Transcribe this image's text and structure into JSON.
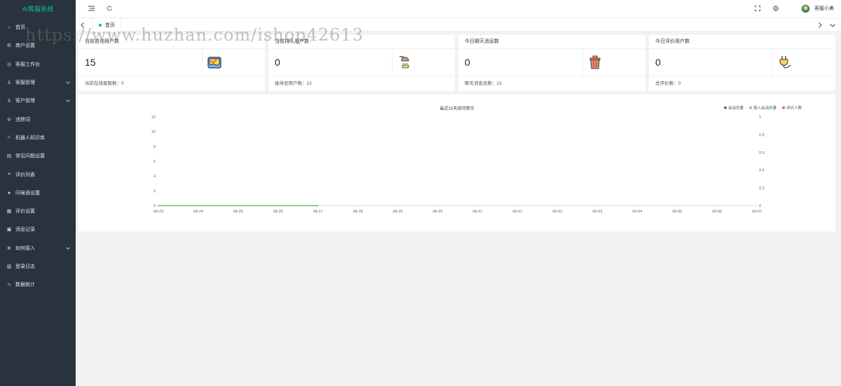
{
  "app": {
    "title": "AI客服系统",
    "brand_color": "#16baaa"
  },
  "sidebar": {
    "items": [
      {
        "label": "首页",
        "icon": "home-icon",
        "has_children": false
      },
      {
        "label": "商户设置",
        "icon": "settings-icon",
        "has_children": false
      },
      {
        "label": "客服工作台",
        "icon": "workbench-icon",
        "has_children": false
      },
      {
        "label": "客服管理",
        "icon": "user-icon",
        "has_children": true
      },
      {
        "label": "客户管理",
        "icon": "users-icon",
        "has_children": true
      },
      {
        "label": "违禁词",
        "icon": "ban-icon",
        "has_children": false
      },
      {
        "label": "机器人知识库",
        "icon": "robot-icon",
        "has_children": false
      },
      {
        "label": "常见问题设置",
        "icon": "faq-icon",
        "has_children": false
      },
      {
        "label": "评价列表",
        "icon": "list-icon",
        "has_children": false
      },
      {
        "label": "问候语设置",
        "icon": "send-icon",
        "has_children": false
      },
      {
        "label": "评价设置",
        "icon": "calendar-icon",
        "has_children": false
      },
      {
        "label": "消息记录",
        "icon": "message-icon",
        "has_children": false
      },
      {
        "label": "如何接入",
        "icon": "link-icon",
        "has_children": true
      },
      {
        "label": "登录日志",
        "icon": "log-icon",
        "has_children": false
      },
      {
        "label": "数据统计",
        "icon": "stats-icon",
        "has_children": false
      }
    ]
  },
  "header": {
    "user_name": "客服小美"
  },
  "tabs": {
    "active": "首页"
  },
  "cards": [
    {
      "title": "当前咨询用户数",
      "value": "15",
      "footer": "当前在线客服数：0",
      "icon": "clipboard-icon"
    },
    {
      "title": "当前排队用户数",
      "value": "0",
      "footer": "接待总用户数：12",
      "icon": "shower-icon"
    },
    {
      "title": "今日聊天消息数",
      "value": "0",
      "footer": "聊天消息总数：12",
      "icon": "trash-icon"
    },
    {
      "title": "今日评价用户数",
      "value": "0",
      "footer": "总评价数：0",
      "icon": "plug-icon"
    }
  ],
  "watermark": "https://www.huzhan.com/ishop42613",
  "chart_data": {
    "type": "line",
    "title": "最近15天接待情况",
    "categories": [
      "08-23",
      "08-24",
      "08-25",
      "08-26",
      "08-27",
      "08-28",
      "08-29",
      "08-30",
      "08-31",
      "09-01",
      "09-02",
      "09-03",
      "09-04",
      "09-05",
      "09-06",
      "09-07"
    ],
    "series": [
      {
        "name": "会话总量",
        "color": "#5470c6",
        "axis": "left",
        "values": [
          0,
          0,
          0,
          0,
          0,
          null,
          null,
          null,
          null,
          null,
          null,
          null,
          null,
          null,
          null,
          null
        ]
      },
      {
        "name": "接入会话总量",
        "color": "#91cc75",
        "axis": "left",
        "values": [
          0,
          0,
          0,
          0,
          0,
          null,
          null,
          null,
          null,
          null,
          null,
          null,
          null,
          null,
          null,
          null
        ]
      },
      {
        "name": "评价人数",
        "color": "#ee6666",
        "axis": "right",
        "values": [
          null,
          null,
          null,
          null,
          null,
          null,
          null,
          null,
          null,
          null,
          null,
          null,
          null,
          null,
          null,
          null
        ]
      }
    ],
    "yleft": {
      "ticks": [
        "0",
        "2",
        "4",
        "6",
        "8",
        "10",
        "12"
      ],
      "min": 0,
      "max": 12
    },
    "yright": {
      "ticks": [
        "0",
        "0.2",
        "0.4",
        "0.6",
        "0.8",
        "1"
      ],
      "min": 0,
      "max": 1
    },
    "legend_position": "top-right",
    "grid": false
  }
}
